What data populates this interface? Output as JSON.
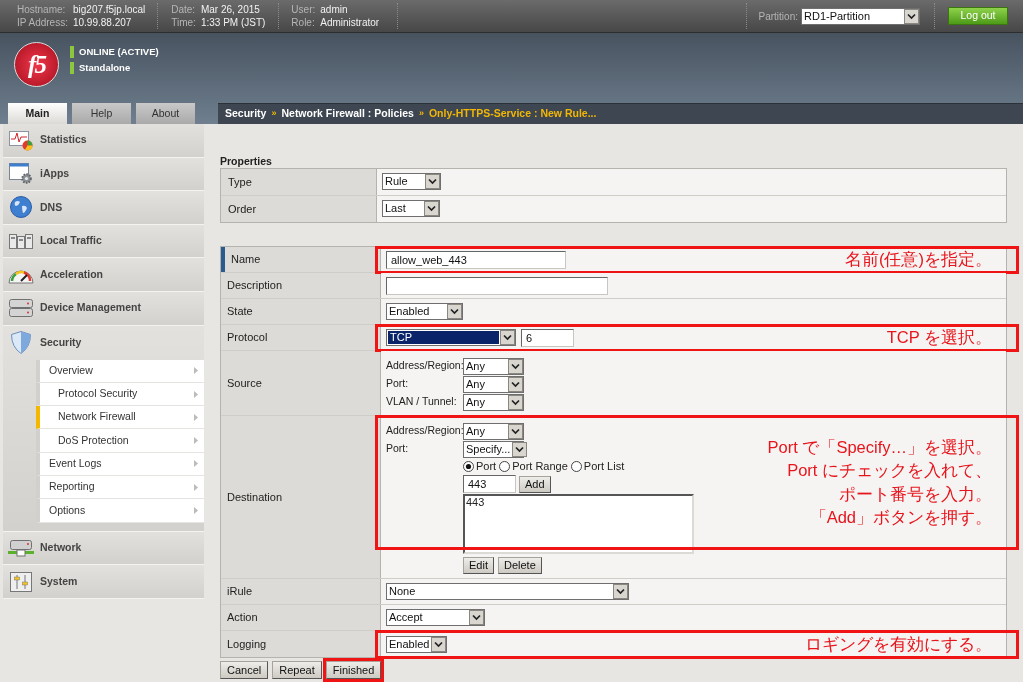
{
  "top_bar": {
    "info_groups": [
      [
        {
          "label": "Hostname:",
          "value": "big207.f5jp.local"
        },
        {
          "label": "IP Address:",
          "value": "10.99.88.207"
        }
      ],
      [
        {
          "label": "Date:",
          "value": "Mar 26, 2015"
        },
        {
          "label": "Time:",
          "value": "1:33 PM (JST)"
        }
      ],
      [
        {
          "label": "User:",
          "value": "admin"
        },
        {
          "label": "Role:",
          "value": "Administrator"
        }
      ]
    ],
    "partition": {
      "label": "Partition:",
      "value": "RD1-Partition"
    },
    "logout_button": "Log out"
  },
  "header": {
    "logo": "f5",
    "status": [
      "ONLINE (ACTIVE)",
      "Standalone"
    ]
  },
  "tabs": [
    {
      "label": "Main",
      "selected": true
    },
    {
      "label": "Help",
      "selected": false
    },
    {
      "label": "About",
      "selected": false
    }
  ],
  "breadcrumb": [
    {
      "kind": "link",
      "text": "Security"
    },
    {
      "kind": "separator",
      "text": "»"
    },
    {
      "kind": "link",
      "text": "Network Firewall : Policies"
    },
    {
      "kind": "separator",
      "text": "»"
    },
    {
      "kind": "current",
      "text": "Only-HTTPS-Service : New Rule..."
    }
  ],
  "sidebar": {
    "items": [
      {
        "label": "Statistics",
        "expanded": false
      },
      {
        "label": "iApps",
        "expanded": false
      },
      {
        "label": "DNS",
        "expanded": false
      },
      {
        "label": "Local Traffic",
        "expanded": false
      },
      {
        "label": "Acceleration",
        "expanded": false
      },
      {
        "label": "Device Management",
        "expanded": false
      },
      {
        "label": "Security",
        "expanded": true,
        "children": [
          {
            "label": "Overview",
            "selected": false,
            "children": [
              {
                "label": "Protocol Security",
                "selected": false
              },
              {
                "label": "Network Firewall",
                "selected": true
              },
              {
                "label": "DoS Protection",
                "selected": false
              }
            ]
          },
          {
            "label": "Event Logs",
            "selected": false
          },
          {
            "label": "Reporting",
            "selected": false
          },
          {
            "label": "Options",
            "selected": false
          }
        ]
      },
      {
        "label": "Network",
        "expanded": false
      },
      {
        "label": "System",
        "expanded": false
      }
    ]
  },
  "properties": {
    "title": "Properties",
    "rows": [
      {
        "label": "Type",
        "kind": "select",
        "value": "Rule"
      },
      {
        "label": "Order",
        "kind": "select",
        "value": "Last"
      }
    ]
  },
  "rule_form": {
    "rows": [
      {
        "label": "Name",
        "kind": "text",
        "required": true,
        "value": "allow_web_443",
        "annotation": {
          "lines": [
            "名前(任意)を指定。"
          ]
        }
      },
      {
        "label": "Description",
        "kind": "text",
        "required": false
      },
      {
        "label": "State",
        "kind": "select",
        "required": false,
        "value": "Enabled"
      },
      {
        "label": "Protocol",
        "kind": "protocol",
        "required": false,
        "value": "TCP",
        "focused": true,
        "number": "6",
        "annotation": {
          "lines": [
            "TCP を選択。"
          ]
        }
      },
      {
        "label": "Source",
        "kind": "endpoint",
        "required": false,
        "fields": [
          {
            "label": "Address/Region:",
            "value": "Any"
          },
          {
            "label": "Port:",
            "value": "Any"
          },
          {
            "label": "VLAN / Tunnel:",
            "value": "Any"
          }
        ]
      },
      {
        "label": "Destination",
        "kind": "endpoint",
        "required": false,
        "fields": [
          {
            "label": "Address/Region:",
            "value": "Any"
          },
          {
            "label": "Port:",
            "value": "Specify..."
          }
        ],
        "port_modes": [
          {
            "label": "Port",
            "selected": true
          },
          {
            "label": "Port Range",
            "selected": false
          },
          {
            "label": "Port List",
            "selected": false
          }
        ],
        "port_input": "443",
        "add_button": "Add",
        "port_list": [
          "443"
        ],
        "list_buttons": [
          "Edit",
          "Delete"
        ],
        "annotation": {
          "lines": [
            "Port で「Specify…」を選択。",
            "Port にチェックを入れて、",
            "ポート番号を入力。",
            "「Add」ボタンを押す。"
          ]
        }
      },
      {
        "label": "iRule",
        "kind": "select",
        "required": false,
        "value": "None"
      },
      {
        "label": "Action",
        "kind": "select",
        "required": false,
        "value": "Accept"
      },
      {
        "label": "Logging",
        "kind": "select",
        "required": false,
        "value": "Enabled",
        "annotation": {
          "lines": [
            "ロギングを有効にする。"
          ]
        }
      }
    ]
  },
  "buttons": [
    {
      "label": "Cancel",
      "highlighted": false
    },
    {
      "label": "Repeat",
      "highlighted": false
    },
    {
      "label": "Finished",
      "highlighted": true
    }
  ]
}
